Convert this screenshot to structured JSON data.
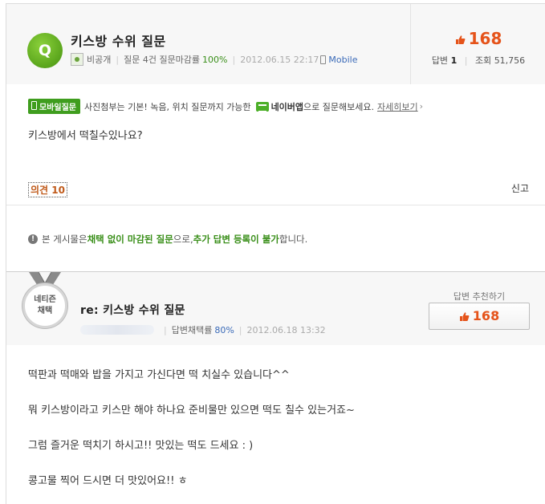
{
  "question": {
    "badge": "Q",
    "title": "키스방 수위 질문",
    "author": "비공개",
    "stats_prefix": "질문 4건 질문마감률",
    "close_rate": "100%",
    "datetime": "2012.06.15 22:17",
    "device": "Mobile",
    "likes": "168",
    "answers_label": "답변",
    "answers_count": "1",
    "views_label": "조회",
    "views_count": "51,756",
    "promo": {
      "tag": "모바일질문",
      "text": "사진첨부는 기본! 녹음, 위치 질문까지 가능한",
      "app": "네이버앱",
      "text2": "으로 질문해보세요.",
      "link": "자세히보기",
      "arrow": "›"
    },
    "body": "키스방에서 떡칠수있나요?",
    "opinion": "의견 10",
    "report": "신고",
    "notice": {
      "icon": "!",
      "p1": "본 게시물은 ",
      "h1": "채택 없이 마감된 질문",
      "p2": "으로, ",
      "h2": "추가 답변 등록이 불가",
      "p3": "합니다."
    }
  },
  "answer": {
    "medal_line1": "네티즌",
    "medal_line2": "채택",
    "title": "re: 키스방 수위 질문",
    "adopt_label": "답변채택률",
    "adopt_rate": "80%",
    "datetime": "2012.06.18 13:32",
    "recommend_label": "답변 추천하기",
    "likes": "168",
    "lines": [
      "떡판과 떡매와 밥을 가지고 가신다면 떡 치실수 있습니다^^",
      "뭐 키스방이라고 키스만 해야 하나요 준비물만 있으면 떡도 칠수 있는거죠~",
      "그럼 즐거운 떡치기 하시고!! 맛있는 떡도 드세요 : )",
      "콩고물 찍어 드시면 더 맛있어요!! ㅎ"
    ]
  },
  "colors": {
    "accent_orange": "#e5531a",
    "green": "#3a8f1a",
    "badge_green": "#5aa51c"
  }
}
